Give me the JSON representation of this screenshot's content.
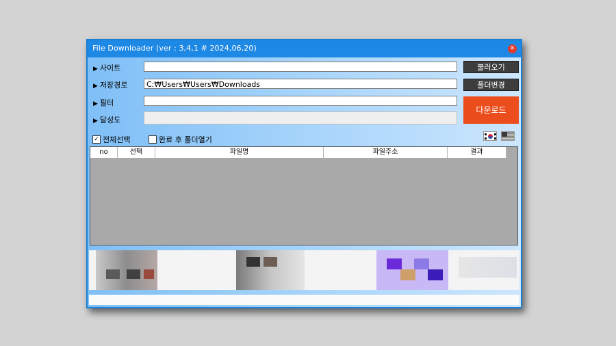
{
  "window": {
    "title": "File Downloader (ver : 3,4,1 # 2024,06,20)",
    "close_glyph": "✕"
  },
  "form": {
    "arrow_glyph": "▶",
    "site_label": "사이트",
    "site_value": "",
    "save_path_label": "저장경로",
    "save_path_value": "C:₩Users₩Users₩Downloads",
    "filter_label": "필터",
    "filter_value": "",
    "progress_label": "달성도",
    "progress_value": 0
  },
  "buttons": {
    "load": "불러오기",
    "change_folder": "폴더변경",
    "download": "다운로드"
  },
  "options": {
    "select_all_label": "전체선택",
    "select_all_checked": true,
    "open_folder_label": "완료 후 폴더열기",
    "open_folder_checked": false,
    "check_glyph": "✓"
  },
  "flags": [
    "korea-flag-icon",
    "usa-flag-icon"
  ],
  "table": {
    "columns": [
      "no",
      "선택",
      "파일명",
      "파일주소",
      "결과"
    ],
    "rows": []
  },
  "colors": {
    "titlebar": "#1e88e5",
    "download_button": "#ec4d1c",
    "dark_button": "#3d3d3d"
  }
}
